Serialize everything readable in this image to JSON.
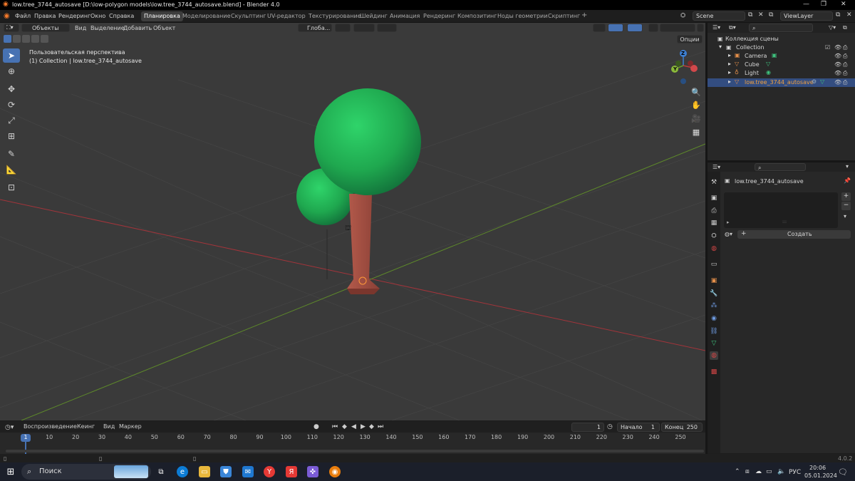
{
  "window": {
    "title": "low.tree_3744_autosave [D:\\low-polygon models\\low.tree_3744_autosave.blend] - Blender 4.0",
    "min": "—",
    "max": "❐",
    "close": "✕"
  },
  "menu": [
    "Файл",
    "Правка",
    "Рендеринг",
    "Окно",
    "Справка"
  ],
  "workspaces": [
    "Планировка",
    "Моделирование",
    "Скульптинг",
    "UV-редактор",
    "Текстурирование",
    "Шейдинг",
    "Анимация",
    "Рендеринг",
    "Композитинг",
    "Ноды геометрии",
    "Скриптинг"
  ],
  "workspace_add": "+",
  "scene": {
    "label": "Scene",
    "view_layer": "ViewLayer"
  },
  "viewport": {
    "mode": "Объекты",
    "menus": [
      "Вид",
      "Выделение",
      "Добавить",
      "Объект"
    ],
    "orientation": "Глоба...",
    "options": "Опции",
    "overlay_line1": "Пользовательская перспектива",
    "overlay_line2": "(1) Collection | low.tree_3744_autosave",
    "gizmo": {
      "z": "Z",
      "y": "Y",
      "x": "X"
    }
  },
  "colors": {
    "accent": "#4772b3",
    "foliage": "#1fa84f",
    "trunk": "#a35245",
    "x_axis": "#c0393b",
    "y_axis": "#6b9a2c",
    "z_axis": "#3d7fd1",
    "selected_row": "#334d80"
  },
  "timeline": {
    "menus": [
      "Воспроизведение",
      "Кеинг",
      "Вид",
      "Маркер"
    ],
    "current_frame": "1",
    "start_label": "Начало",
    "start": "1",
    "end_label": "Конец",
    "end": "250",
    "ticks": [
      "1",
      "10",
      "20",
      "30",
      "40",
      "50",
      "60",
      "70",
      "80",
      "90",
      "100",
      "110",
      "120",
      "130",
      "140",
      "150",
      "160",
      "170",
      "180",
      "190",
      "200",
      "210",
      "220",
      "230",
      "240",
      "250"
    ]
  },
  "outliner": {
    "root": "Коллекция сцены",
    "collection": "Collection",
    "items": [
      {
        "label": "Camera",
        "icon": "camera-icon"
      },
      {
        "label": "Cube",
        "icon": "mesh-icon"
      },
      {
        "label": "Light",
        "icon": "light-icon"
      },
      {
        "label": "low.tree_3744_autosave",
        "icon": "mesh-icon"
      }
    ]
  },
  "properties": {
    "object_name": "low.tree_3744_autosave",
    "new_button": "Создать",
    "add": "+",
    "remove": "−"
  },
  "status": {
    "version": "4.0.2"
  },
  "taskbar": {
    "search": "Поиск",
    "lang": "РУС",
    "time": "20:06",
    "date": "05.01.2024"
  }
}
